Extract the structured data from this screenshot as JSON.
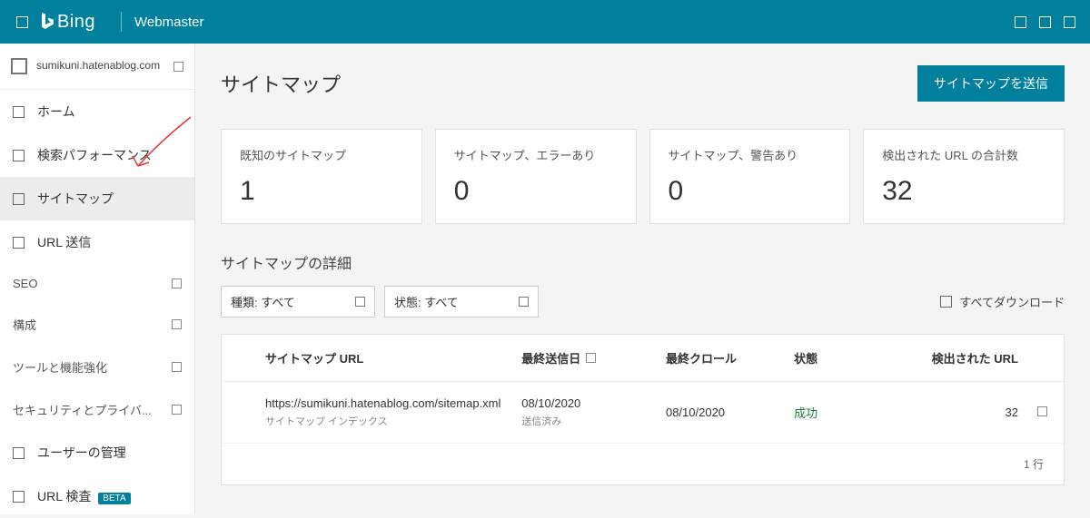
{
  "header": {
    "brand": "Bing",
    "product": "Webmaster"
  },
  "sidebar": {
    "site_name": "sumikuni.hatenablog.com",
    "items": [
      {
        "label": "ホーム"
      },
      {
        "label": "検索パフォーマンス"
      },
      {
        "label": "サイトマップ",
        "active": true
      },
      {
        "label": "URL 送信"
      }
    ],
    "sections": [
      {
        "label": "SEO"
      },
      {
        "label": "構成"
      },
      {
        "label": "ツールと機能強化"
      },
      {
        "label": "セキュリティとプライバ..."
      }
    ],
    "items_bottom": [
      {
        "label": "ユーザーの管理"
      },
      {
        "label": "URL 検査",
        "beta": "BETA"
      }
    ]
  },
  "page": {
    "title": "サイトマップ",
    "submit_button": "サイトマップを送信"
  },
  "stats": [
    {
      "label": "既知のサイトマップ",
      "value": "1"
    },
    {
      "label": "サイトマップ、エラーあり",
      "value": "0"
    },
    {
      "label": "サイトマップ、警告あり",
      "value": "0"
    },
    {
      "label": "検出された URL の合計数",
      "value": "32"
    }
  ],
  "detail": {
    "title": "サイトマップの詳細",
    "filter_type": "種類: すべて",
    "filter_status": "状態: すべて",
    "download_all": "すべてダウンロード",
    "columns": {
      "url": "サイトマップ URL",
      "last_submit": "最終送信日",
      "last_crawl": "最終クロール",
      "status": "状態",
      "discovered": "検出された URL"
    },
    "rows": [
      {
        "url": "https://sumikuni.hatenablog.com/sitemap.xml",
        "sub": "サイトマップ インデックス",
        "last_submit": "08/10/2020",
        "submit_status": "送信済み",
        "last_crawl": "08/10/2020",
        "status": "成功",
        "discovered": "32"
      }
    ],
    "footer_rows": "1 行"
  }
}
